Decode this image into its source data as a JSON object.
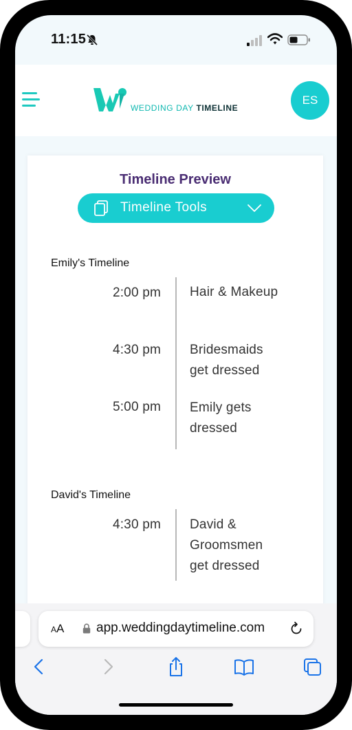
{
  "status_bar": {
    "time": "11:15"
  },
  "header": {
    "logo_text_1": "WEDDING DAY",
    "logo_text_2": "TIMELINE",
    "avatar_initials": "ES"
  },
  "preview": {
    "title": "Timeline Preview",
    "tools_button_label": "Timeline Tools"
  },
  "timelines": [
    {
      "heading": "Emily's Timeline",
      "events": [
        {
          "time": "2:00 pm",
          "line1": "Hair & Makeup",
          "line2": "",
          "line3": ""
        },
        {
          "time": "4:30 pm",
          "line1": "Bridesmaids",
          "line2": "get dressed",
          "line3": ""
        },
        {
          "time": "5:00 pm",
          "line1": "Emily gets",
          "line2": "dressed",
          "line3": ""
        }
      ]
    },
    {
      "heading": "David's Timeline",
      "events": [
        {
          "time": "4:30 pm",
          "line1": "David &",
          "line2": "Groomsmen",
          "line3": "get dressed"
        }
      ]
    }
  ],
  "browser": {
    "aa_small": "A",
    "aa_large": "A",
    "url": "app.weddingdaytimeline.com"
  },
  "colors": {
    "accent": "#19cdd0",
    "title_purple": "#4a2d73",
    "ios_blue": "#1a73e8"
  }
}
